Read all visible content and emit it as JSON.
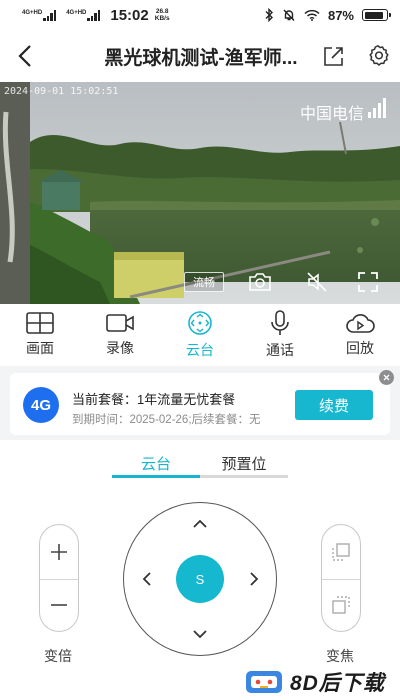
{
  "status_bar": {
    "sim1_label": "4G+HD",
    "sim2_label": "4G+HD",
    "time": "15:02",
    "net_speed_value": "26.8",
    "net_speed_unit": "KB/s",
    "battery_percent": "87%",
    "battery_level": 0.87
  },
  "header": {
    "title": "黑光球机测试-渔军师...",
    "back_icon": "chevron-left-icon",
    "share_icon": "share-icon",
    "settings_icon": "gear-icon"
  },
  "video": {
    "timestamp": "2024-09-01 15:02:51",
    "carrier": "中国电信",
    "quality_label": "流畅",
    "controls": [
      "camera-icon",
      "mute-icon",
      "fullscreen-icon"
    ]
  },
  "function_tabs": [
    {
      "label": "画面",
      "icon": "grid-icon",
      "active": false
    },
    {
      "label": "录像",
      "icon": "video-camera-icon",
      "active": false
    },
    {
      "label": "云台",
      "icon": "ptz-icon",
      "active": true
    },
    {
      "label": "通话",
      "icon": "microphone-icon",
      "active": false
    },
    {
      "label": "回放",
      "icon": "cloud-play-icon",
      "active": false
    }
  ],
  "package": {
    "badge": "4G",
    "current_plan": "当前套餐：1年流量无忧套餐",
    "expiry": "到期时间：2025-02-26;后续套餐：无",
    "renew_label": "续费"
  },
  "ptz": {
    "tabs": [
      {
        "label": "云台",
        "active": true
      },
      {
        "label": "预置位",
        "active": false
      }
    ],
    "center_label": "S",
    "zoom_label": "变倍",
    "focus_label": "变焦"
  },
  "watermark": {
    "text": "8D后下载"
  },
  "colors": {
    "accent": "#18b6ce",
    "badge_blue": "#1e6ff0"
  }
}
